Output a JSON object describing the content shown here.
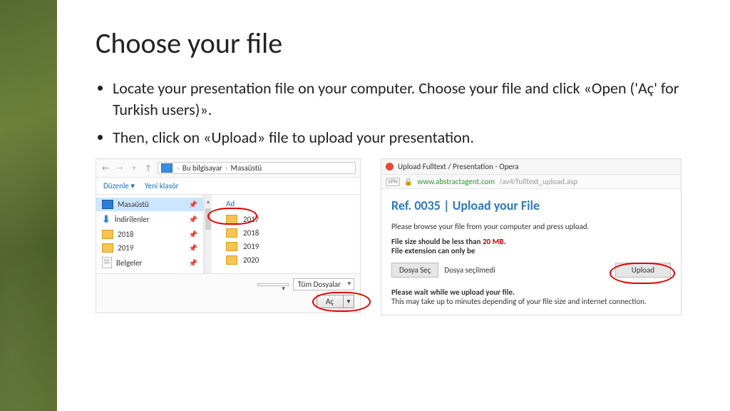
{
  "title": "Choose your file",
  "bullets": [
    "Locate your presentation file on your computer. Choose your file and click «Open ('Aç' for Turkish users)».",
    "Then, click on «Upload» file to upload your presentation."
  ],
  "explorer": {
    "breadcrumb": {
      "root": "Bu bilgisayar",
      "current": "Masaüstü"
    },
    "toolbar": {
      "organize": "Düzenle",
      "new_folder": "Yeni klasör"
    },
    "tree": [
      {
        "icon": "monitor",
        "label": "Masaüstü",
        "selected": true
      },
      {
        "icon": "download",
        "label": "İndirilenler"
      },
      {
        "icon": "folder",
        "label": "2018"
      },
      {
        "icon": "folder",
        "label": "2019"
      },
      {
        "icon": "document",
        "label": "Belgeler"
      }
    ],
    "column_header": "Ad",
    "files": [
      "2017",
      "2018",
      "2019",
      "2020"
    ],
    "highlight_index": 0,
    "filter_label": "Tüm Dosyalar",
    "open_label": "Aç"
  },
  "opera": {
    "window_title": "Upload Fulltext / Presentation - Opera",
    "vpn_badge": "VPN",
    "url_host": "www.abstractagent.com",
    "url_path": "/av4/fulltext_upload.asp",
    "heading": "Ref. 0035 | Upload your File",
    "intro": "Please browse your file from your computer and press upload.",
    "size_line_a": "File size should be less than ",
    "size_limit": "20 MB.",
    "ext_line": "File extension can only be",
    "choose_btn": "Dosya Seç",
    "no_file": "Dosya seçilmedi",
    "upload_btn": "Upload",
    "wait_bold": "Please wait while we upload your file.",
    "wait_note": "This may take up to minutes depending of your file size and internet connection."
  }
}
